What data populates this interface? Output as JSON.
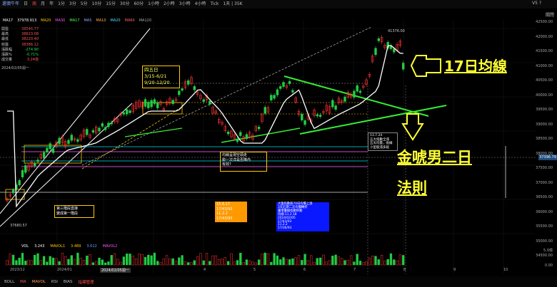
{
  "toolbar": {
    "app_label": "還價牛年",
    "buttons": [
      "日",
      "周",
      "月",
      "年",
      "1分",
      "3分",
      "5分",
      "10分",
      "15分",
      "30分",
      "60分",
      "1小時",
      "2小時",
      "3小時",
      "4小時",
      "Tick",
      "1天 | 35K"
    ],
    "active_index": 1,
    "help_label": "V5 ?"
  },
  "ma_line": {
    "symbol": "MA17",
    "value": "37978.913",
    "items": [
      "MA20",
      "MA30",
      "MA17",
      "MA5",
      "MA10",
      "MA20",
      "MA60",
      "MA120"
    ]
  },
  "info": [
    {
      "label": "開盤",
      "value": "38546.77",
      "color": "red"
    },
    {
      "label": "最高",
      "value": "38623.08",
      "color": "red"
    },
    {
      "label": "最低",
      "value": "38220.40",
      "color": "red"
    },
    {
      "label": "收盤",
      "value": "38386.12",
      "color": "red"
    },
    {
      "label": "漲跌幅",
      "value": "-274.90",
      "color": "green"
    },
    {
      "label": "漲跌%",
      "value": "-0.71%",
      "color": "green"
    },
    {
      "label": "成交量",
      "value": "3.24億",
      "color": "red"
    }
  ],
  "date_label": "2024/02/05週一",
  "date_label_top": "2024/02/05週一",
  "right_axis": [
    "42500.00",
    "42000.00",
    "41500.00",
    "41000.00",
    "40500.00",
    "40000.00",
    "39500.00",
    "39000.00",
    "38500.00",
    "38000.00",
    "37500.00",
    "37000.00",
    "36500.00",
    "36000.00",
    "35500.00",
    "35000.00",
    "34500.00"
  ],
  "price_badge": "37396.79",
  "close_label": "關閉",
  "peak_label": "41376.00",
  "low_label": "37680.57",
  "annotations": {
    "season": [
      "四五日",
      "3/15-6/21",
      "9/20-12/20"
    ],
    "stage3": [
      "第三階段直接",
      "變成第一階段"
    ],
    "wave": [
      "均線呈現空頭走",
      "勢一次洋是否降內",
      "有效?"
    ],
    "orange": [
      "15.6.17",
      "17/43/93",
      "11.2.2",
      "17/43/93"
    ],
    "blue": [
      "大盤指數跌70日均價上漲",
      "3天近期二次均價轉折",
      "量增量縮指數移動",
      "均線:11.2.18",
      "2024/02/05",
      "17/43/93",
      "11.2.2",
      "17/36/93"
    ],
    "small": [
      "13.7.24",
      "五大指數全漲",
      "五天均量，長線",
      "小型股漲多殺"
    ],
    "ma17": "17日均線",
    "rule_line1": "金唬男二日",
    "rule_line2": "法則"
  },
  "volume": {
    "label": "VOL",
    "vol": "3.243",
    "mavol1_label": "MAVOL1",
    "mavol1": "3.489",
    "mavol1b": "3.612",
    "mavol2_label": "MAVOL2"
  },
  "vol_axis": [
    "5.0億",
    "0.00"
  ],
  "x_axis": [
    "2023/12",
    "2024/01",
    "2024/02/05週一",
    "4",
    "5",
    "6",
    "7",
    "8",
    "9",
    "10"
  ],
  "bottom": [
    "BOLL",
    "MA",
    "MAVOL",
    "RSI",
    "BIAS",
    "指標管理"
  ],
  "colors": {
    "up": "#ff3333",
    "down": "#22cc44",
    "ma": "#ffffff",
    "trend": "#33dd33",
    "accent": "#ffff33"
  }
}
